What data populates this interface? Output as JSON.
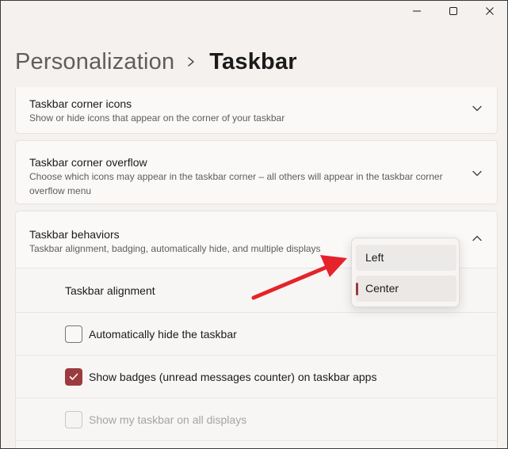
{
  "window": {
    "controls": [
      "minimize-icon",
      "maximize-icon",
      "close-icon"
    ]
  },
  "header": {
    "parent": "Personalization",
    "separator_icon": "chevron-right-icon",
    "current": "Taskbar"
  },
  "cards": {
    "corner_icons": {
      "title": "Taskbar corner icons",
      "description": "Show or hide icons that appear on the corner of your taskbar",
      "expanded": false
    },
    "corner_overflow": {
      "title": "Taskbar corner overflow",
      "description": "Choose which icons may appear in the taskbar corner – all others will appear in the taskbar corner overflow menu",
      "expanded": false
    },
    "behaviors": {
      "title": "Taskbar behaviors",
      "description": "Taskbar alignment, badging, automatically hide, and multiple displays",
      "expanded": true,
      "alignment_label": "Taskbar alignment",
      "options": [
        {
          "label": "Left",
          "checked": false,
          "disabled": false
        },
        {
          "label": "Show badges (unread messages counter) on taskbar apps",
          "checked": true,
          "disabled": false
        },
        {
          "label": "Show my taskbar on all displays",
          "checked": false,
          "disabled": true
        }
      ],
      "auto_hide_label": "Automatically hide the taskbar"
    }
  },
  "alignment_dropdown": {
    "items": [
      "Left",
      "Center"
    ],
    "selected": "Center"
  },
  "colors": {
    "accent": "#9b3b3f",
    "annotation_arrow": "#e5232b",
    "background": "#f4f1ef"
  }
}
